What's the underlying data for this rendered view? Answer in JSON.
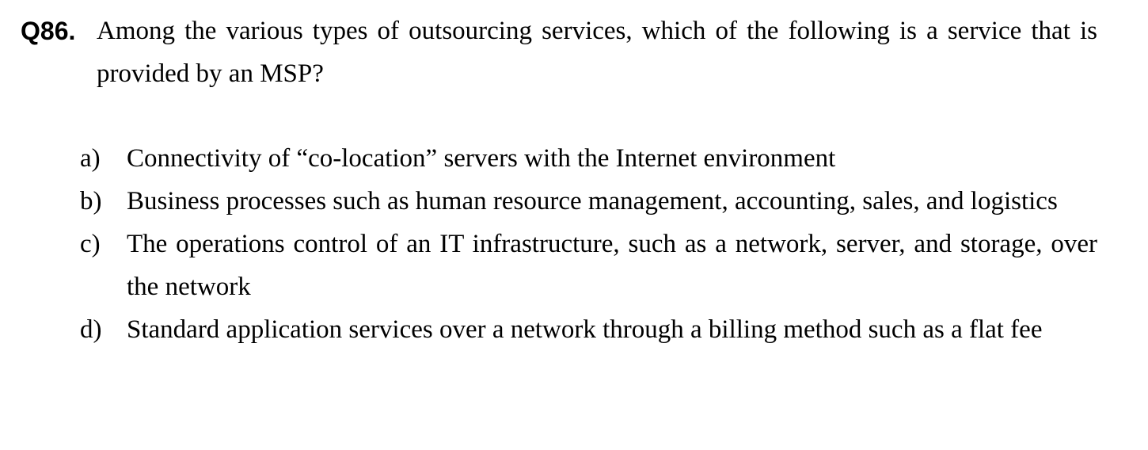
{
  "question": {
    "number": "Q86.",
    "text": "Among the various types of outsourcing services, which of the following is a service that is provided by an MSP?"
  },
  "options": [
    {
      "letter": "a)",
      "text": "Connectivity of “co-location” servers with the Internet environment"
    },
    {
      "letter": "b)",
      "text": "Business processes such as human resource management, accounting, sales, and logistics"
    },
    {
      "letter": "c)",
      "text": "The operations control of an IT infrastructure, such as a network, server, and storage, over the network"
    },
    {
      "letter": "d)",
      "text": "Standard application services over a network through a billing method such as a flat fee"
    }
  ]
}
